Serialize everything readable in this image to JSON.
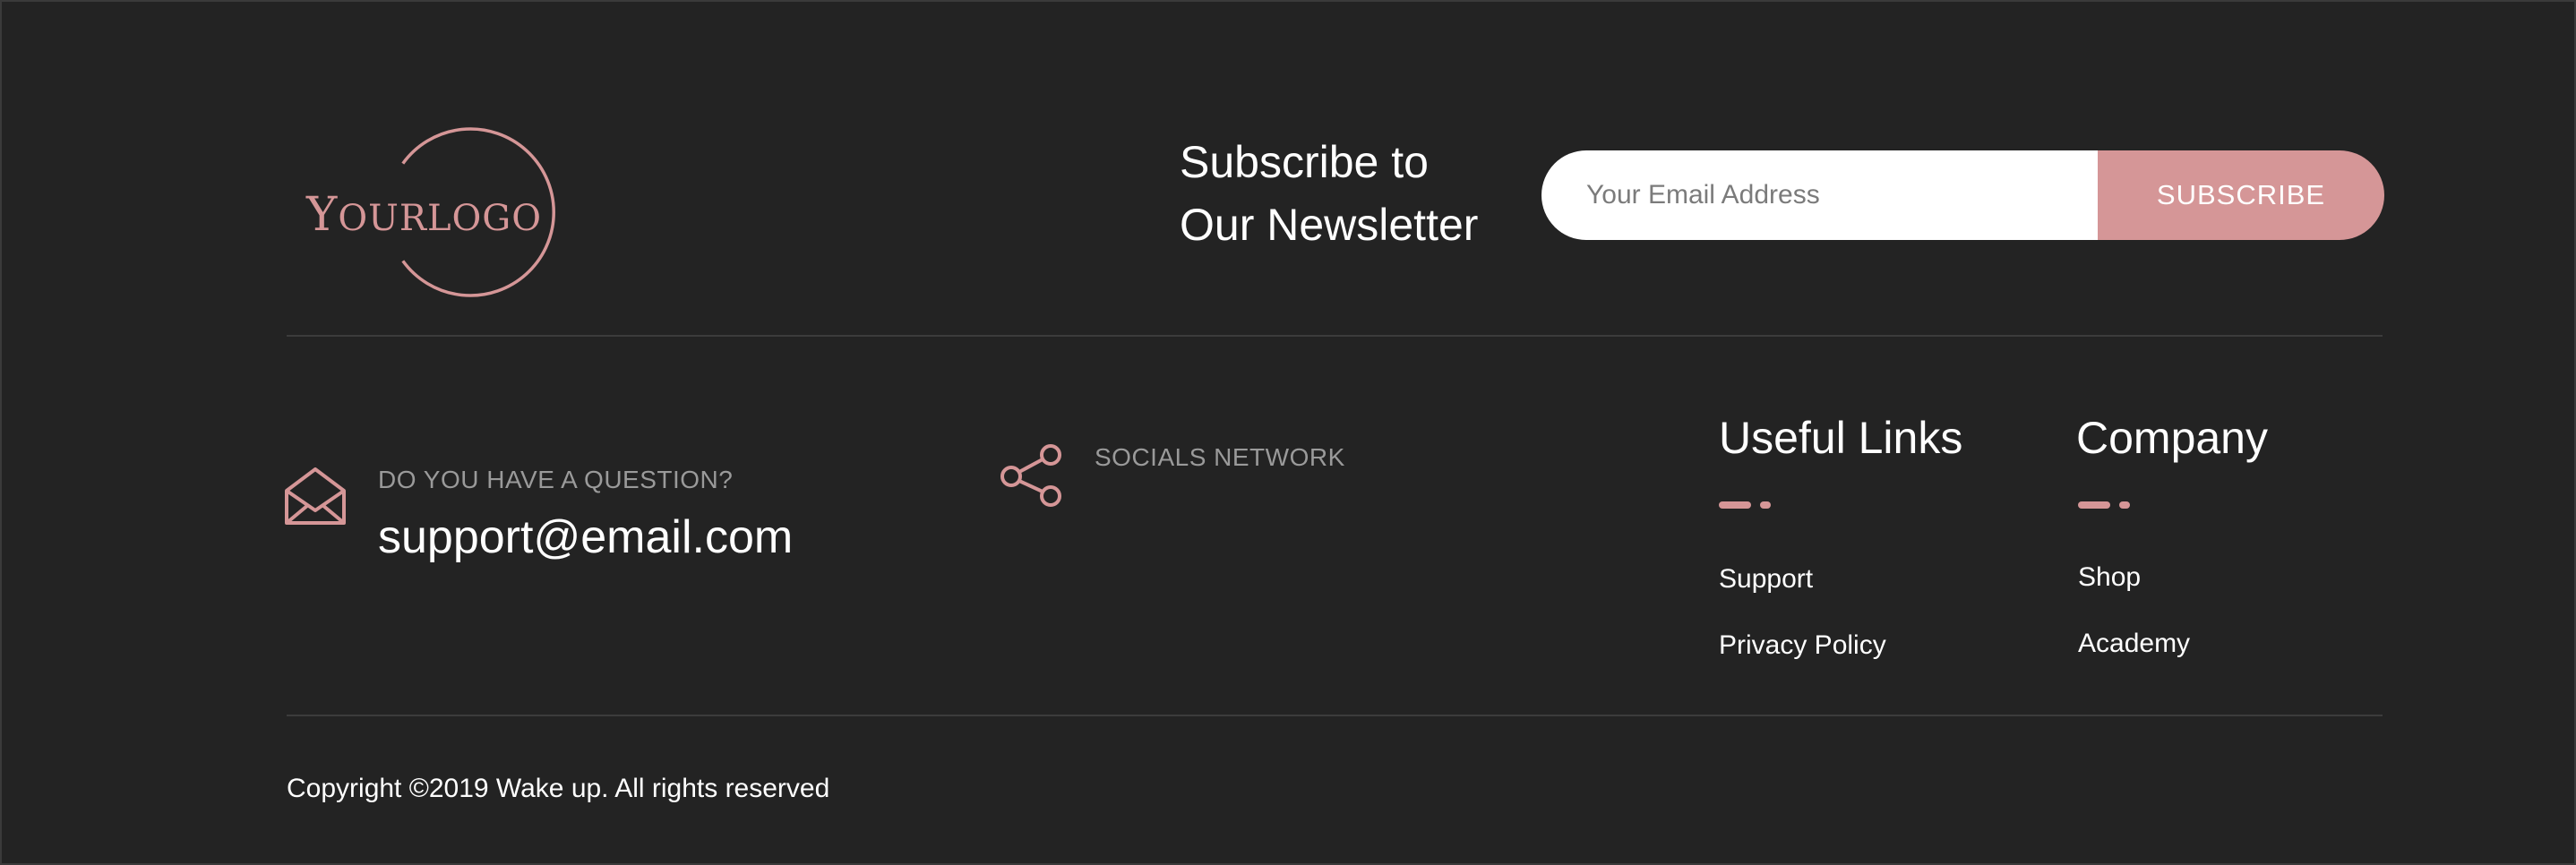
{
  "logo": {
    "text_first": "Y",
    "text_rest": "OURLOGO"
  },
  "newsletter": {
    "title_line1": "Subscribe to",
    "title_line2": "Our Newsletter",
    "input_placeholder": "Your Email Address",
    "button_label": "SUBSCRIBE"
  },
  "contact": {
    "label": "DO YOU HAVE A QUESTION?",
    "email": "support@email.com",
    "icon": "envelope-open-icon"
  },
  "socials": {
    "label": "SOCIALS NETWORK",
    "icon": "share-icon"
  },
  "useful_links": {
    "title": "Useful Links",
    "items": [
      "Support",
      "Privacy Policy"
    ]
  },
  "company": {
    "title": "Company",
    "items": [
      "Shop",
      "Academy"
    ]
  },
  "copyright": "Copyright ©2019 Wake up. All rights reserved",
  "colors": {
    "background": "#232323",
    "accent": "#d59697",
    "text": "#ffffff",
    "muted": "#9a9a9a",
    "divider": "#3c3c3c"
  }
}
